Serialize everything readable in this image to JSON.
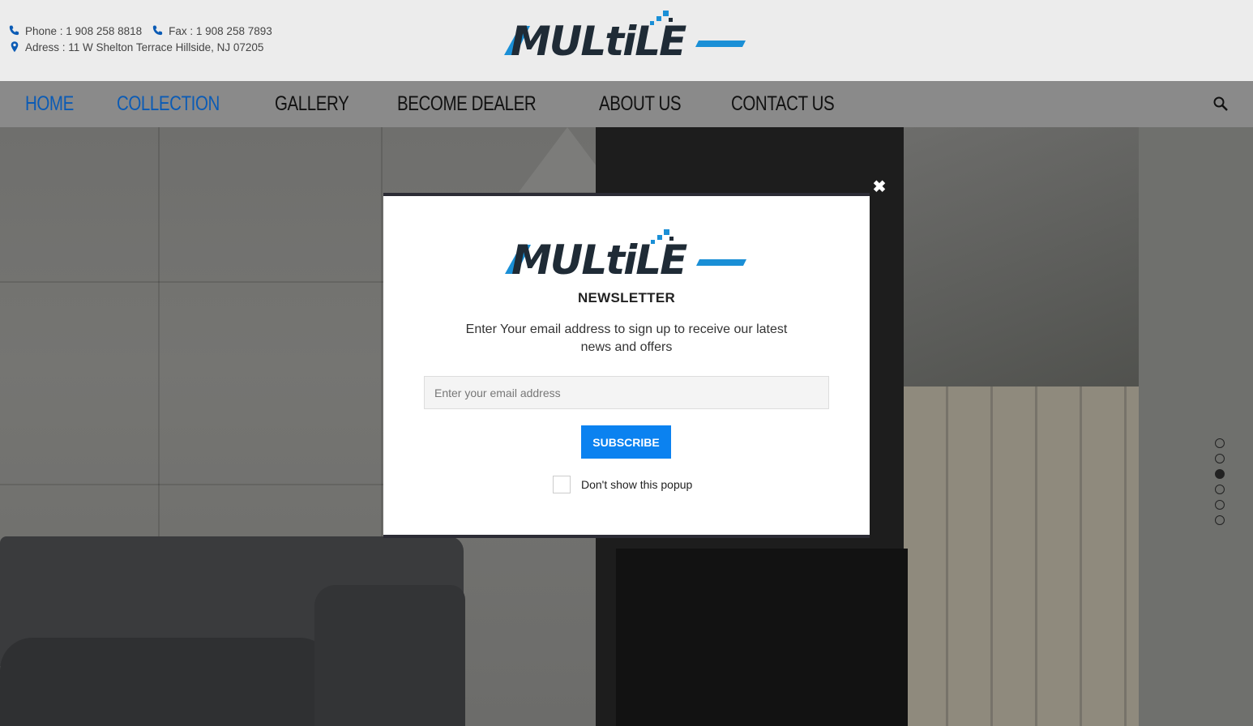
{
  "header": {
    "phone": "Phone : 1 908 258 8818",
    "fax": "Fax : 1 908 258 7893",
    "address": "Adress : 11 W Shelton Terrace Hillside, NJ 07205",
    "logo_text": "MULtiLE",
    "phone_icon": "phone-icon",
    "address_icon": "map-pin-icon"
  },
  "nav": {
    "items": [
      {
        "label": "HOME",
        "active": true
      },
      {
        "label": "COLLECTION",
        "active": true
      },
      {
        "label": "GALLERY",
        "active": false
      },
      {
        "label": "BECOME DEALER",
        "active": false
      },
      {
        "label": "ABOUT US",
        "active": false
      },
      {
        "label": "CONTACT US",
        "active": false
      }
    ],
    "search_icon": "search-icon"
  },
  "slider": {
    "dot_count": 6,
    "active_index": 2
  },
  "popup": {
    "logo_text": "MULtiLE",
    "title": "NEWSLETTER",
    "description": "Enter Your email address to sign up to receive our latest news and offers",
    "email_placeholder": "Enter your email address",
    "email_value": "",
    "subscribe_label": "SUBSCRIBE",
    "dont_show_label": "Don't show this popup",
    "close_icon": "close-icon"
  },
  "colors": {
    "brand_blue": "#0b5bb5",
    "button_blue": "#0b82f0",
    "logo_dark": "#1f2b36",
    "logo_accent": "#1a8fd6"
  }
}
